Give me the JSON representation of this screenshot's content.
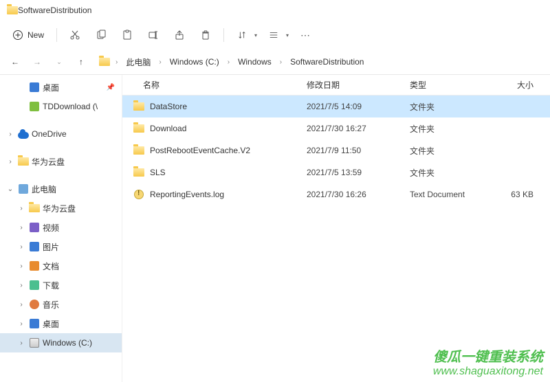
{
  "titlebar": {
    "title": "SoftwareDistribution"
  },
  "toolbar": {
    "new_label": "New"
  },
  "breadcrumb": {
    "items": [
      "此电脑",
      "Windows (C:)",
      "Windows",
      "SoftwareDistribution"
    ]
  },
  "sidebar": {
    "items": [
      {
        "label": "桌面",
        "icon": "blue",
        "indent": 1,
        "arrow": "",
        "pin": true
      },
      {
        "label": "TDDownload (\\",
        "icon": "green",
        "indent": 1,
        "arrow": ""
      },
      {
        "spacer": true
      },
      {
        "label": "OneDrive",
        "icon": "cloud",
        "indent": 0,
        "arrow": "›"
      },
      {
        "spacer": true
      },
      {
        "label": "华为云盘",
        "icon": "folder",
        "indent": 0,
        "arrow": "›"
      },
      {
        "spacer": true
      },
      {
        "label": "此电脑",
        "icon": "pc",
        "indent": 0,
        "arrow": "⌄"
      },
      {
        "label": "华为云盘",
        "icon": "folder",
        "indent": 1,
        "arrow": "›"
      },
      {
        "label": "视频",
        "icon": "purple",
        "indent": 1,
        "arrow": "›"
      },
      {
        "label": "图片",
        "icon": "blue",
        "indent": 1,
        "arrow": "›"
      },
      {
        "label": "文档",
        "icon": "orange",
        "indent": 1,
        "arrow": "›"
      },
      {
        "label": "下载",
        "icon": "down",
        "indent": 1,
        "arrow": "›"
      },
      {
        "label": "音乐",
        "icon": "music",
        "indent": 1,
        "arrow": "›"
      },
      {
        "label": "桌面",
        "icon": "blue",
        "indent": 1,
        "arrow": "›"
      },
      {
        "label": "Windows (C:)",
        "icon": "disk",
        "indent": 1,
        "arrow": "›",
        "selected": true
      }
    ]
  },
  "columns": {
    "name": "名称",
    "date": "修改日期",
    "type": "类型",
    "size": "大小"
  },
  "files": [
    {
      "name": "DataStore",
      "date": "2021/7/5 14:09",
      "type": "文件夹",
      "size": "",
      "icon": "folder",
      "selected": true
    },
    {
      "name": "Download",
      "date": "2021/7/30 16:27",
      "type": "文件夹",
      "size": "",
      "icon": "folder"
    },
    {
      "name": "PostRebootEventCache.V2",
      "date": "2021/7/9 11:50",
      "type": "文件夹",
      "size": "",
      "icon": "folder"
    },
    {
      "name": "SLS",
      "date": "2021/7/5 13:59",
      "type": "文件夹",
      "size": "",
      "icon": "folder"
    },
    {
      "name": "ReportingEvents.log",
      "date": "2021/7/30 16:26",
      "type": "Text Document",
      "size": "63 KB",
      "icon": "log"
    }
  ],
  "watermark": {
    "line1": "傻瓜一键重装系统",
    "line2": "www.shaguaxitong.net"
  }
}
